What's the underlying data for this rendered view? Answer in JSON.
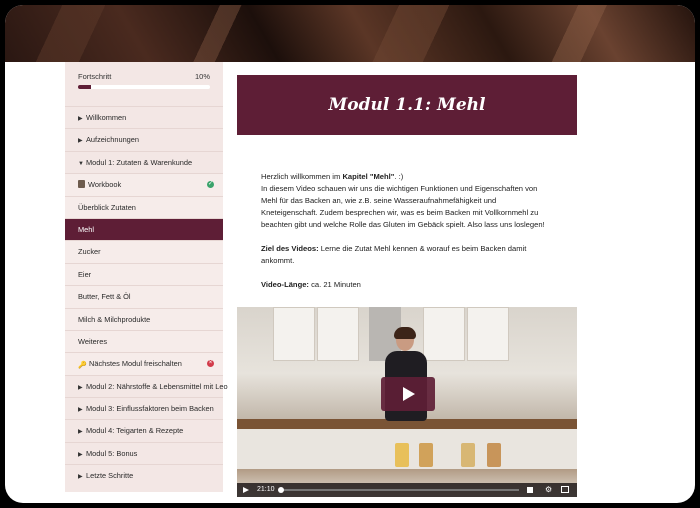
{
  "progress": {
    "label": "Fortschritt",
    "percent_text": "10%",
    "fraction": 0.1
  },
  "sidebar": {
    "items": [
      {
        "label": "Willkommen",
        "type": "module"
      },
      {
        "label": "Aufzeichnungen",
        "type": "module"
      },
      {
        "label": "Modul 1: Zutaten & Warenkunde",
        "type": "module-open"
      },
      {
        "label": "Workbook",
        "type": "lesson",
        "icon": "book-icon",
        "status": "complete"
      },
      {
        "label": "Überblick Zutaten",
        "type": "lesson"
      },
      {
        "label": "Mehl",
        "type": "lesson",
        "active": true
      },
      {
        "label": "Zucker",
        "type": "lesson"
      },
      {
        "label": "Eier",
        "type": "lesson"
      },
      {
        "label": "Butter, Fett & Öl",
        "type": "lesson"
      },
      {
        "label": "Milch & Milchprodukte",
        "type": "lesson"
      },
      {
        "label": "Weiteres",
        "type": "lesson"
      },
      {
        "label": "Nächstes Modul freischalten",
        "type": "lesson",
        "icon": "key-icon",
        "status": "locked"
      },
      {
        "label": "Modul 2: Nährstoffe & Lebensmittel mit Leo",
        "type": "module"
      },
      {
        "label": "Modul 3: Einflussfaktoren beim Backen",
        "type": "module"
      },
      {
        "label": "Modul 4: Teigarten & Rezepte",
        "type": "module"
      },
      {
        "label": "Modul 5: Bonus",
        "type": "module"
      },
      {
        "label": "Letzte Schritte",
        "type": "module"
      }
    ]
  },
  "main": {
    "title": "Modul 1.1: Mehl",
    "intro_prefix": "Herzlich willkommen im ",
    "intro_bold": "Kapitel \"Mehl\"",
    "intro_suffix": ". :)",
    "intro_body": "In diesem Video schauen wir uns die wichtigen Funktionen und Eigenschaften von Mehl für das Backen an, wie z.B. seine Wasseraufnahmefähigkeit und Kneteigenschaft. Zudem besprechen wir, was es beim Backen mit Vollkornmehl zu beachten gibt und welche Rolle das Gluten im Gebäck spielt. Also lass uns loslegen!",
    "goal_label": "Ziel des Videos:",
    "goal_text": " Lerne die Zutat Mehl kennen & worauf es beim Backen damit ankommt.",
    "length_label": "Video-Länge:",
    "length_text": " ca. 21 Minuten"
  },
  "video": {
    "time": "21:10"
  },
  "colors": {
    "accent": "#5e1e36",
    "sidebar_bg": "#f3e7e5",
    "ok": "#3aa36b",
    "error": "#d23b4b"
  }
}
